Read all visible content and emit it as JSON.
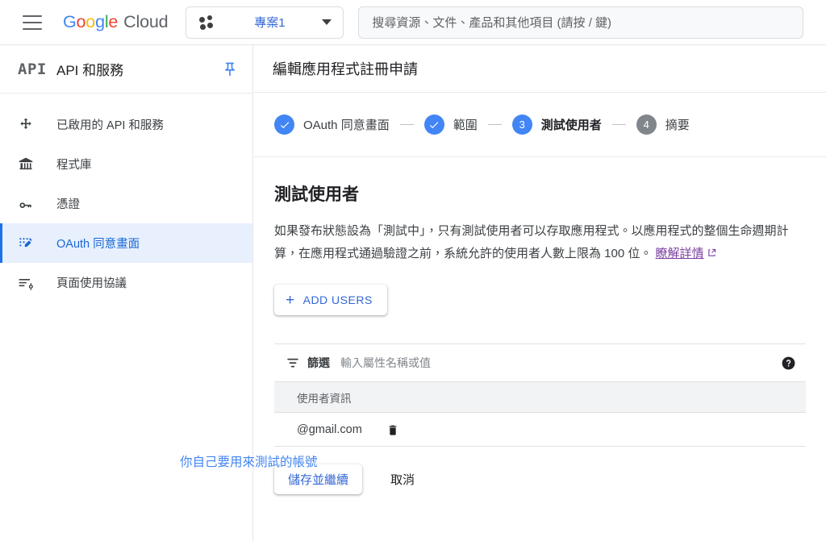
{
  "topbar": {
    "menu_icon": "hamburger-menu-icon",
    "brand": {
      "g1": "G",
      "o1": "o",
      "o2": "o",
      "g2": "g",
      "l": "l",
      "e": "e",
      "cloud": "Cloud"
    },
    "project_chip": {
      "icon": "project-dots-icon",
      "label": "專案1",
      "caret": "chevron-down-icon"
    },
    "search": {
      "placeholder": "搜尋資源、文件、產品和其他項目 (請按 / 鍵)",
      "value": ""
    }
  },
  "sidebar": {
    "logo_text": "API",
    "title": "API 和服務",
    "pin_icon": "pin-icon",
    "items": [
      {
        "icon": "enabled-apis-icon",
        "label": "已啟用的 API 和服務",
        "active": false
      },
      {
        "icon": "library-icon",
        "label": "程式庫",
        "active": false
      },
      {
        "icon": "key-icon",
        "label": "憑證",
        "active": false
      },
      {
        "icon": "oauth-consent-icon",
        "label": "OAuth 同意畫面",
        "active": true
      },
      {
        "icon": "page-usage-agreement-icon",
        "label": "頁面使用協議",
        "active": false
      }
    ]
  },
  "content": {
    "header_title": "編輯應用程式註冊申請",
    "stepper": [
      {
        "state": "done",
        "badge": "✓",
        "label": "OAuth 同意畫面"
      },
      {
        "state": "done",
        "badge": "✓",
        "label": "範圍"
      },
      {
        "state": "current",
        "badge": "3",
        "label": "測試使用者"
      },
      {
        "state": "todo",
        "badge": "4",
        "label": "摘要"
      }
    ],
    "section_title": "測試使用者",
    "description_part1": "如果發布狀態設為「測試中」，只有測試使用者可以存取應用程式。以應用程式的整個生命週期計算，在應用程式通過驗證之前，系統允許的使用者人數上限為 100 位。",
    "description_link": "瞭解詳情",
    "link_external_icon": "external-link-icon",
    "add_users_button": {
      "icon": "plus-icon",
      "label": "ADD USERS"
    },
    "table": {
      "filter_icon": "filter-icon",
      "filter_label": "篩選",
      "filter_placeholder": "輸入屬性名稱或值",
      "help_icon": "help-circle-icon",
      "columns": [
        "使用者資訊"
      ],
      "rows": [
        {
          "email": "@gmail.com",
          "delete_icon": "trash-icon"
        }
      ]
    },
    "footer": {
      "save_label": "儲存並繼續",
      "cancel_label": "取消"
    }
  },
  "annotation": {
    "text": "你自己要用來測試的帳號",
    "color": "#4285f4"
  },
  "colors": {
    "google_blue": "#4285F4",
    "google_red": "#EA4335",
    "google_yellow": "#FBBC05",
    "google_green": "#34A853",
    "link_blue": "#3367d6",
    "visited_purple": "#7b3fa0",
    "active_bg": "#e8f0fe",
    "header_grey": "#f1f3f4"
  }
}
